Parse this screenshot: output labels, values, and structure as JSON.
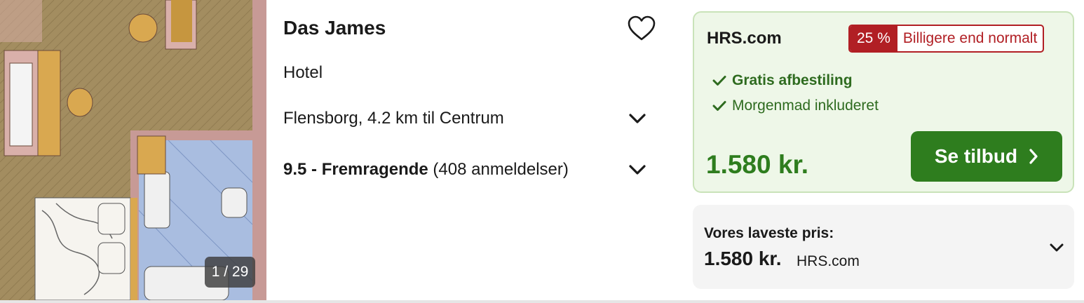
{
  "photo": {
    "counter": "1 / 29"
  },
  "hotel": {
    "name": "Das James",
    "type": "Hotel",
    "location": "Flensborg, 4.2 km til Centrum",
    "rating_score": "9.5 - Fremragende",
    "rating_count": "(408 anmeldelser)"
  },
  "deal": {
    "provider": "HRS.com",
    "discount_pct": "25 %",
    "discount_text": "Billigere end normalt",
    "features": [
      "Gratis afbestiling",
      "Morgenmad inkluderet"
    ],
    "price": "1.580 kr.",
    "cta_label": "Se tilbud"
  },
  "lowest": {
    "label": "Vores laveste pris:",
    "price": "1.580 kr.",
    "provider": "HRS.com"
  },
  "colors": {
    "accent_green": "#2e7d1e",
    "deal_bg": "#eef7e8",
    "discount_red": "#b11f24"
  },
  "icons": [
    "heart-outline-icon",
    "chevron-down-icon",
    "check-icon",
    "chevron-right-icon"
  ]
}
